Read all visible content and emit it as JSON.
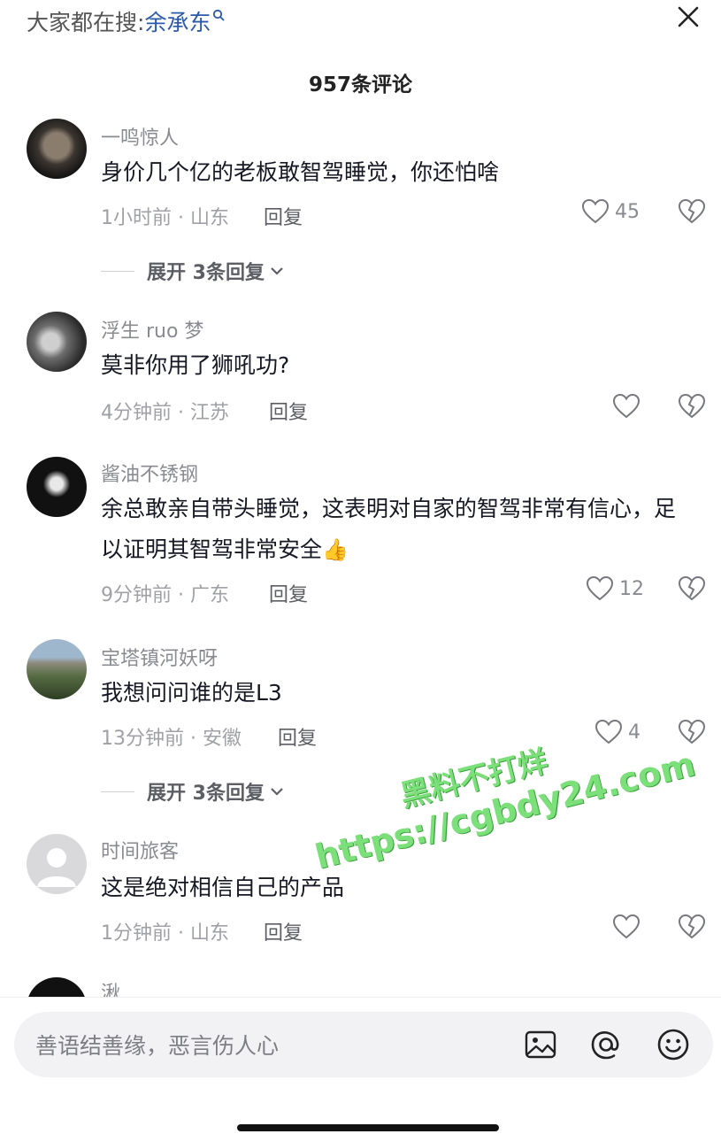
{
  "header": {
    "search_prefix": "大家都在搜:",
    "search_keyword": "余承东",
    "comment_count_title": "957条评论"
  },
  "comments": [
    {
      "username": "一鸣惊人",
      "content": "身价几个亿的老板敢智驾睡觉，你还怕啥",
      "meta": "1小时前 · 山东",
      "reply_label": "回复",
      "likes": "45",
      "expand_label": "展开 3条回复"
    },
    {
      "username": "浮生 ruo 梦",
      "content": "莫非你用了狮吼功?",
      "meta": "4分钟前 · 江苏",
      "reply_label": "回复",
      "likes": ""
    },
    {
      "username": "酱油不锈钢",
      "content": "余总敢亲自带头睡觉，这表明对自家的智驾非常有信心，足以证明其智驾非常安全",
      "meta": "9分钟前 · 广东",
      "reply_label": "回复",
      "likes": "12"
    },
    {
      "username": "宝塔镇河妖呀",
      "content": "我想问问谁的是L3",
      "meta": "13分钟前 · 安徽",
      "reply_label": "回复",
      "likes": "4",
      "expand_label": "展开 3条回复"
    },
    {
      "username": "时间旅客",
      "content": "这是绝对相信自己的产品",
      "meta": "1分钟前 · 山东",
      "reply_label": "回复",
      "likes": ""
    },
    {
      "username": "湫"
    }
  ],
  "watermark": {
    "line1": "黑料不打烊",
    "line2": "https://cgbdy24.com"
  },
  "input": {
    "placeholder": "善语结善缘，恶言伤人心"
  },
  "icons": {
    "search": "search-icon",
    "close": "close-icon",
    "like": "heart-outline-icon",
    "dislike": "broken-heart-icon",
    "expand": "chevron-down-icon",
    "image": "image-icon",
    "mention": "at-icon",
    "emoji": "smiley-icon"
  },
  "colors": {
    "keyword": "#2b5aa8",
    "text": "#161823",
    "meta": "#a0a1a6",
    "watermark": "#7be07a"
  }
}
